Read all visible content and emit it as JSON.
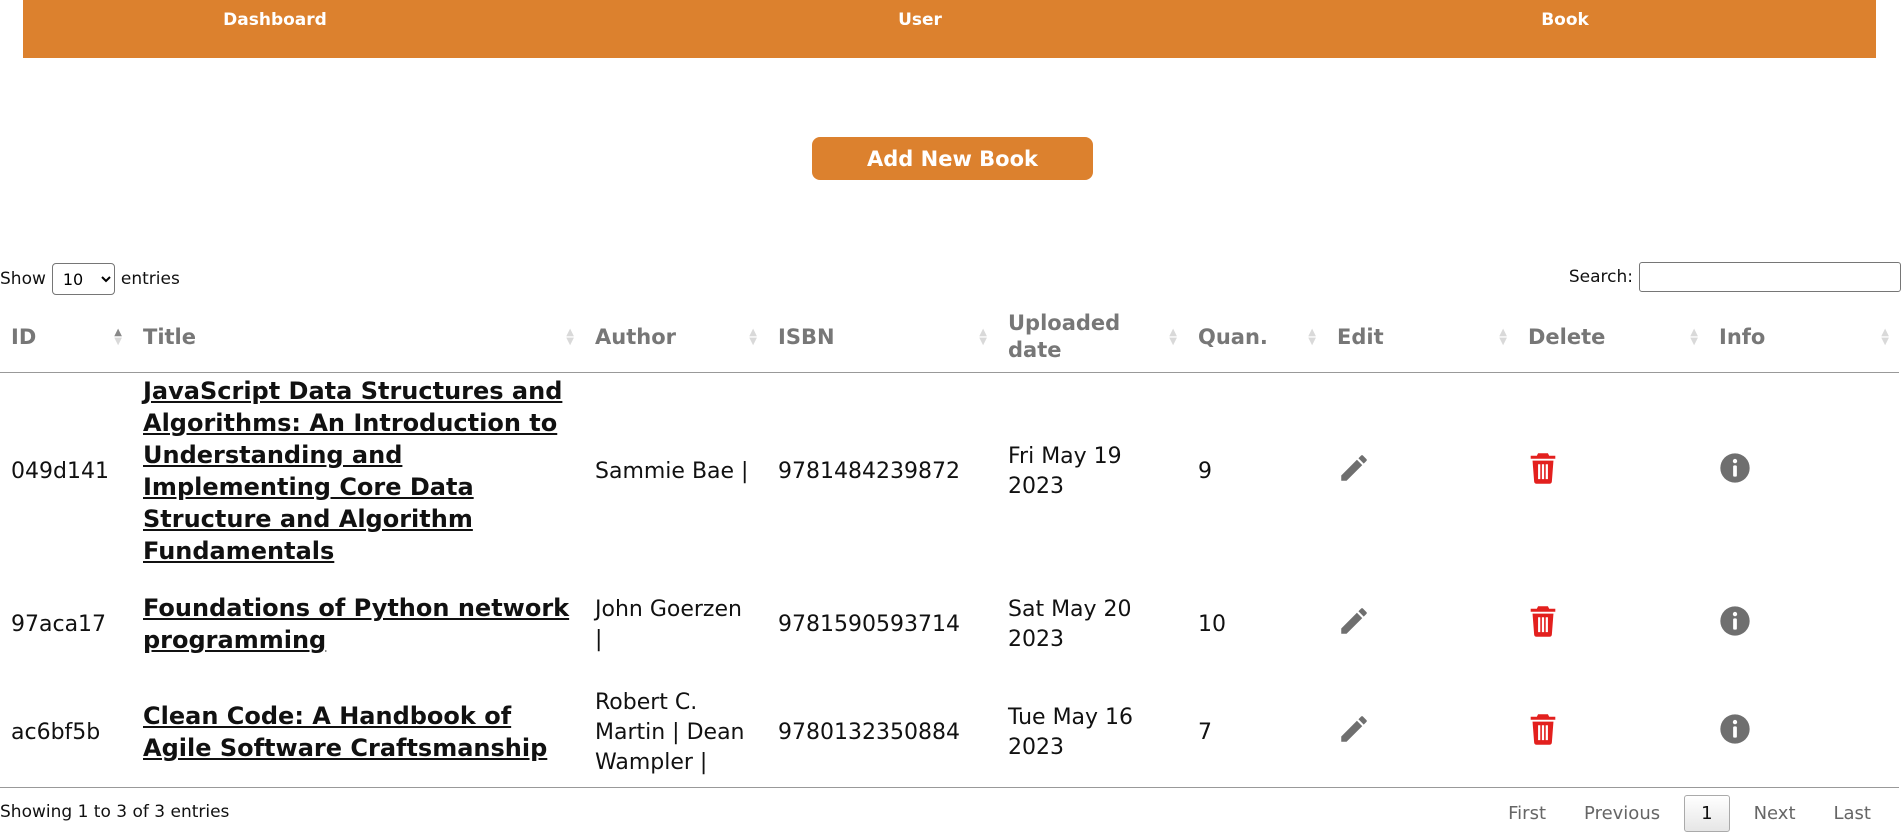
{
  "nav": {
    "items": [
      {
        "label": "Dashboard"
      },
      {
        "label": "User"
      },
      {
        "label": "Book"
      }
    ]
  },
  "actions": {
    "add_label": "Add New Book"
  },
  "table_controls": {
    "show_label": "Show",
    "entries_label": "entries",
    "page_length_value": "10",
    "page_length_options": [
      "10"
    ],
    "search_label": "Search:",
    "search_value": ""
  },
  "table": {
    "headers": [
      "ID",
      "Title",
      "Author",
      "ISBN",
      "Uploaded date",
      "Quan.",
      "Edit",
      "Delete",
      "Info"
    ],
    "rows": [
      {
        "id": "049d141",
        "title": "JavaScript Data Structures and Algorithms: An Introduction to Understanding and Implementing Core Data Structure and Algorithm Fundamentals",
        "author": "Sammie Bae |",
        "isbn": "9781484239872",
        "uploaded": "Fri May 19 2023",
        "quantity": "9"
      },
      {
        "id": "97aca17",
        "title": "Foundations of Python network programming",
        "author": "John Goerzen |",
        "isbn": "9781590593714",
        "uploaded": "Sat May 20 2023",
        "quantity": "10"
      },
      {
        "id": "ac6bf5b",
        "title": "Clean Code: A Handbook of Agile Software Craftsmanship",
        "author": "Robert C. Martin | Dean Wampler |",
        "isbn": "9780132350884",
        "uploaded": "Tue May 16 2023",
        "quantity": "7"
      }
    ]
  },
  "footer": {
    "info": "Showing 1 to 3 of 3 entries",
    "first": "First",
    "previous": "Previous",
    "current_page": "1",
    "next": "Next",
    "last": "Last"
  },
  "colors": {
    "brand": "#dc812e",
    "delete": "#e3201e",
    "icon_gray": "#6f6f6f"
  },
  "icons": {
    "edit": "pencil-icon",
    "delete": "trash-icon",
    "info": "info-circle-icon"
  }
}
